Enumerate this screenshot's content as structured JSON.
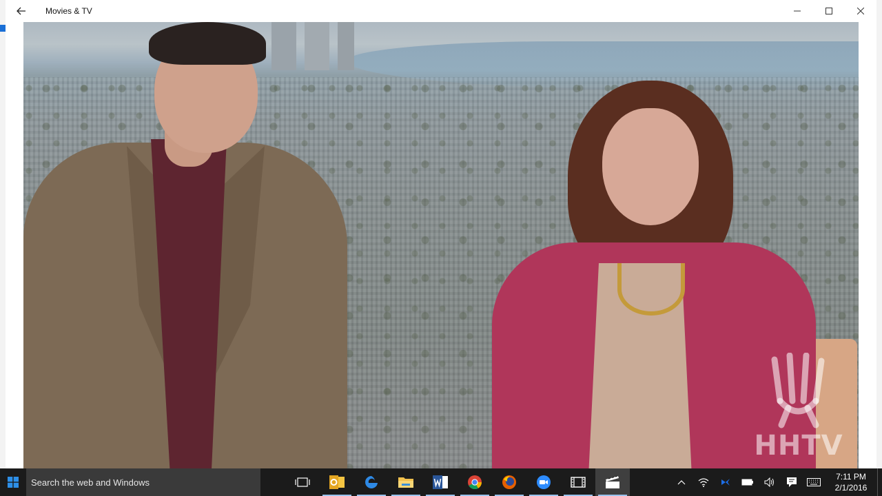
{
  "window": {
    "title": "Movies & TV"
  },
  "video": {
    "watermark": "HHTV"
  },
  "taskbar": {
    "search_placeholder": "Search the web and Windows",
    "pinned": [
      {
        "name": "task-view",
        "label": "Task View"
      },
      {
        "name": "outlook",
        "label": "Outlook"
      },
      {
        "name": "edge",
        "label": "Microsoft Edge"
      },
      {
        "name": "file-explorer",
        "label": "File Explorer"
      },
      {
        "name": "word",
        "label": "Word"
      },
      {
        "name": "chrome",
        "label": "Google Chrome"
      },
      {
        "name": "firefox",
        "label": "Firefox"
      },
      {
        "name": "zoom",
        "label": "Zoom"
      },
      {
        "name": "video-editor",
        "label": "Video editor"
      },
      {
        "name": "movies-tv",
        "label": "Movies & TV"
      }
    ],
    "clock": {
      "time": "7:11 PM",
      "date": "2/1/2016"
    }
  },
  "colors": {
    "taskbar_bg": "#1b1b1b",
    "searchbox_bg": "#3a3a3a",
    "accent": "#1a6fd6",
    "titlebar_bg": "#ffffff"
  }
}
